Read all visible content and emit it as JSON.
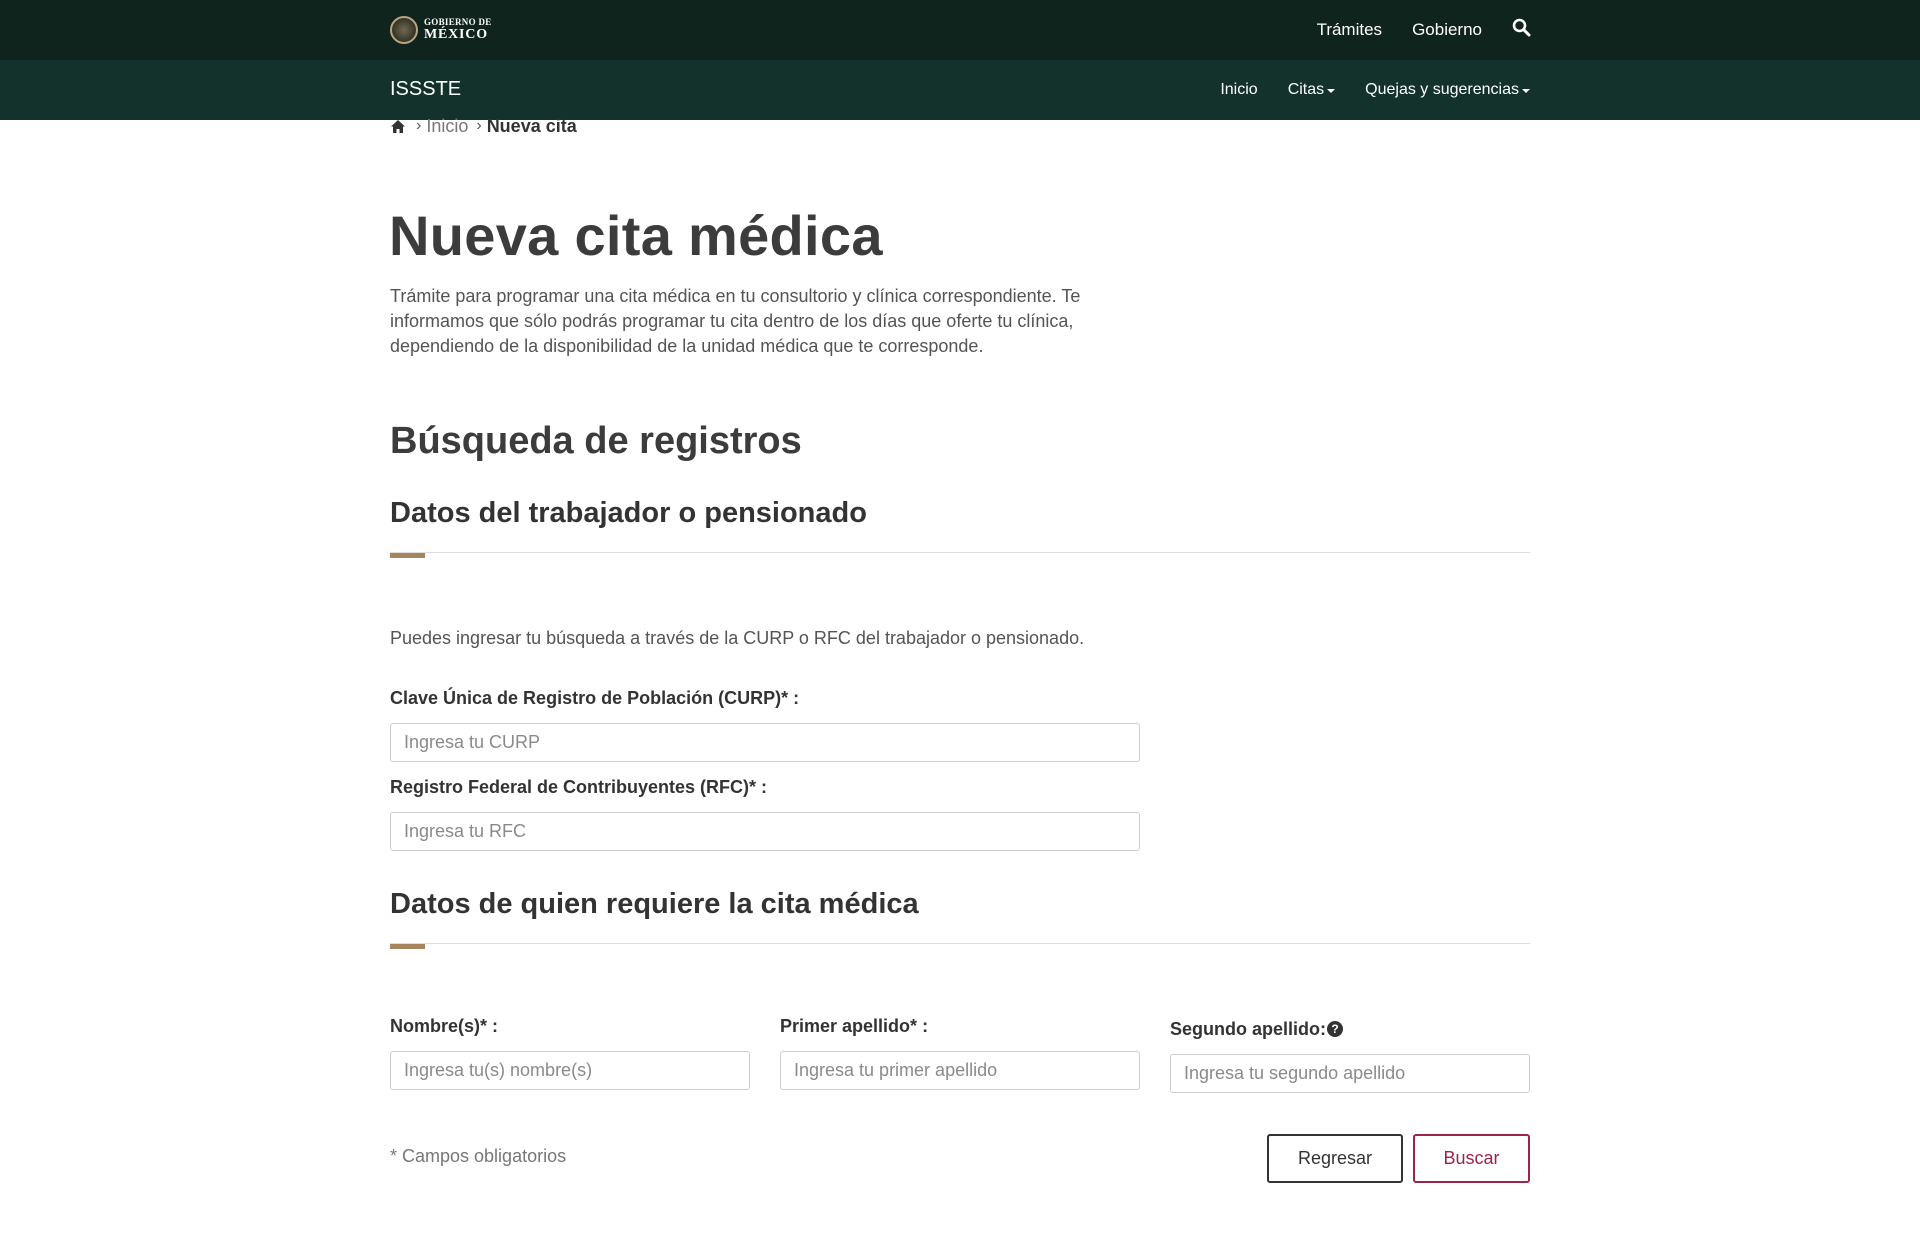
{
  "header": {
    "logo": {
      "line1": "GOBIERNO DE",
      "line2": "MÉXICO"
    },
    "links": [
      "Trámites",
      "Gobierno"
    ],
    "search_icon": "search-icon"
  },
  "subheader": {
    "title": "ISSSTE",
    "nav": [
      {
        "label": "Inicio",
        "dropdown": false
      },
      {
        "label": "Citas",
        "dropdown": true
      },
      {
        "label": "Quejas y sugerencias",
        "dropdown": true
      }
    ]
  },
  "breadcrumb": {
    "home_icon": "home-icon",
    "items": [
      "Inicio",
      "Nueva cita"
    ]
  },
  "page": {
    "title": "Nueva cita médica",
    "intro": "Trámite para programar una cita médica en tu consultorio y clínica correspondiente. Te informamos que sólo podrás programar tu cita dentro de los días que oferte tu clínica, dependiendo de la disponibilidad de la unidad médica que te corresponde."
  },
  "search_section": {
    "title": "Búsqueda de registros",
    "worker": {
      "title": "Datos del trabajador o pensionado",
      "help": "Puedes ingresar tu búsqueda a través de la CURP o RFC del trabajador o pensionado.",
      "curp_label": "Clave Única de Registro de Población (CURP)*",
      "curp_placeholder": "Ingresa tu CURP",
      "rfc_label": "Registro Federal de Contribuyentes (RFC)*",
      "rfc_placeholder": "Ingresa tu RFC"
    },
    "patient": {
      "title": "Datos de quien requiere la cita médica",
      "name_label": "Nombre(s)*",
      "name_placeholder": "Ingresa tu(s) nombre(s)",
      "lastname1_label": "Primer apellido*",
      "lastname1_placeholder": "Ingresa tu primer apellido",
      "lastname2_label": "Segundo apellido:",
      "lastname2_placeholder": "Ingresa tu segundo apellido",
      "help_icon": "question-circle-icon"
    }
  },
  "footer_form": {
    "required_note": "* Campos obligatorios",
    "back_label": "Regresar",
    "search_label": "Buscar"
  },
  "colors": {
    "top_bar": "#10241e",
    "sub_bar": "#13322b",
    "accent": "#a7855d",
    "primary_button": "#9d2449"
  }
}
